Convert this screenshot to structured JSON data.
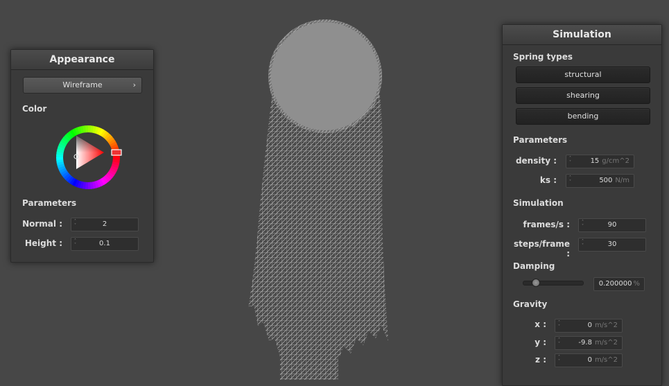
{
  "appearance": {
    "title": "Appearance",
    "mode_label": "Wireframe",
    "mode_chevron": "›",
    "color_label": "Color",
    "color_value_hue_deg": 0,
    "parameters_label": "Parameters",
    "normal": {
      "label": "Normal :",
      "value": "2"
    },
    "height": {
      "label": "Height :",
      "value": "0.1"
    }
  },
  "simulation": {
    "title": "Simulation",
    "spring_types_label": "Spring types",
    "spring_buttons": [
      "structural",
      "shearing",
      "bending"
    ],
    "parameters_label": "Parameters",
    "density": {
      "label": "density :",
      "value": "15",
      "unit": "g/cm^2"
    },
    "ks": {
      "label": "ks :",
      "value": "500",
      "unit": "N/m"
    },
    "simulation_label": "Simulation",
    "frames": {
      "label": "frames/s :",
      "value": "90"
    },
    "steps": {
      "label": "steps/frame :",
      "value": "30"
    },
    "damping_label": "Damping",
    "damping": {
      "value": "0.200000",
      "unit": "%",
      "slider_fraction": 0.2
    },
    "gravity_label": "Gravity",
    "gravity": {
      "x": {
        "label": "x :",
        "value": "0",
        "unit": "m/s^2"
      },
      "y": {
        "label": "y :",
        "value": "-9.8",
        "unit": "m/s^2"
      },
      "z": {
        "label": "z :",
        "value": "0",
        "unit": "m/s^2"
      }
    }
  },
  "colors": {
    "background": "#474747",
    "mesh": "#bdbdbd",
    "panel": "#3a3a3a"
  }
}
